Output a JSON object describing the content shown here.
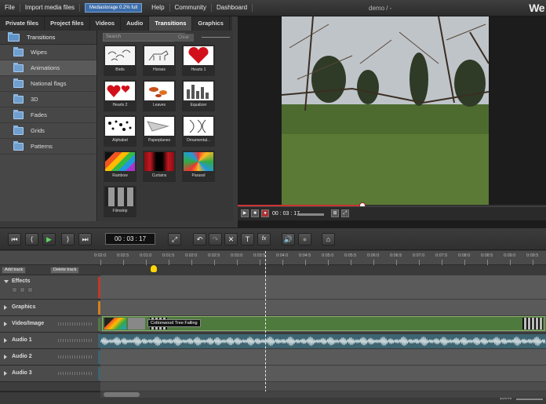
{
  "menubar": {
    "items": [
      "File",
      "Import media files",
      "Help",
      "Community",
      "Dashboard"
    ],
    "storage_badge": "Mediastorage 0.2% full",
    "doc_title": "demo / -",
    "brand": "We"
  },
  "tabs": [
    "Private files",
    "Project files",
    "Videos",
    "Audio",
    "Transitions",
    "Graphics"
  ],
  "categories": {
    "root": "Transitions",
    "items": [
      "Wipes",
      "Animations",
      "National flags",
      "3D",
      "Fades",
      "Grids",
      "Patterns"
    ]
  },
  "effects": {
    "search_placeholder": "Search",
    "clear_label": "Clear",
    "tiles": [
      "Birds",
      "Horses",
      "Hearts 1",
      "Hearts 2",
      "Leaves",
      "Equalizer",
      "Alphabet",
      "Paperplanes",
      "Ornamental...",
      "Rainbow",
      "Curtains",
      "Parasol",
      "Filmstrip"
    ]
  },
  "preview": {
    "time": "00 : 03 : 17",
    "progress": 0.4
  },
  "toolbar": {
    "time": "00 : 03 : 17",
    "buttons": [
      "first",
      "prev",
      "play",
      "next",
      "last",
      "fullscreen",
      "undo",
      "redo",
      "delete",
      "title",
      "fx",
      "volume",
      "record",
      "export"
    ]
  },
  "ruler": {
    "labels": [
      "0:02:0",
      "0:02:5",
      "0:01:0",
      "0:01:5",
      "0:02:0",
      "0:02:5",
      "0:03:0",
      "0:03:5",
      "0:04:0",
      "0:04:5",
      "0:05:0",
      "0:05:5",
      "0:06:0",
      "0:06:5",
      "0:07:0",
      "0:07:5",
      "0:08:0",
      "0:08:5",
      "0:09:0",
      "0:09:5"
    ]
  },
  "timeline": {
    "add_track": "Add track",
    "delete_track": "Delete track",
    "tracks": [
      "Effects",
      "Graphics",
      "Video/Image",
      "Audio 1",
      "Audio 2",
      "Audio 3"
    ],
    "clip_caption": "Cottonwood Tree Falling"
  },
  "status": {
    "zoom": "100%"
  },
  "colors": {
    "accent": "#3c6da8",
    "effects_track": "#c0392b",
    "graphics_track": "#d4821f",
    "video_track": "#4f7a3e",
    "audio_track": "#3d6470",
    "marker": "#ffd600"
  }
}
